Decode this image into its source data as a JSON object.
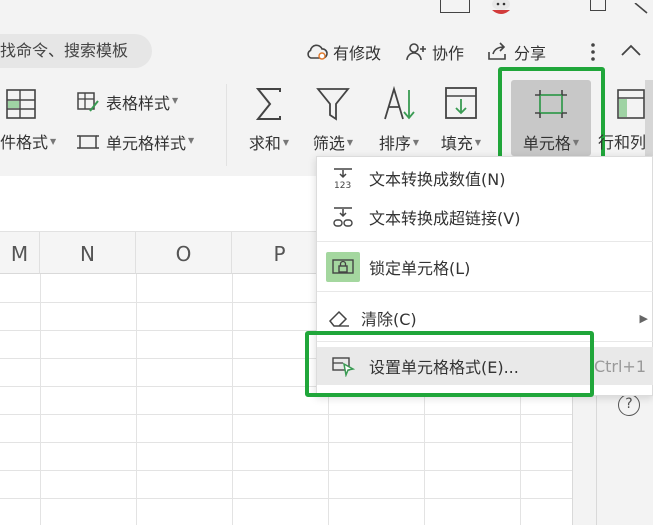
{
  "topbar": {
    "search_text": "找命令、搜索模板",
    "modified_label": "有修改",
    "collab_label": "协作",
    "share_label": "分享"
  },
  "ribbon": {
    "cond_format_label": "件格式",
    "table_style_label": "表格样式",
    "cell_style_label": "单元格样式",
    "sum_label": "求和",
    "filter_label": "筛选",
    "sort_label": "排序",
    "fill_label": "填充",
    "cell_label": "单元格",
    "rowcol_label": "行和列"
  },
  "sheet": {
    "columns": [
      "M",
      "N",
      "O",
      "P"
    ]
  },
  "menu": {
    "items": [
      {
        "label": "文本转换成数值(N)",
        "icon": "text-to-number-icon"
      },
      {
        "label": "文本转换成超链接(V)",
        "icon": "text-to-hyperlink-icon"
      },
      {
        "label": "锁定单元格(L)",
        "icon": "lock-cell-icon"
      },
      {
        "label": "清除(C)",
        "icon": "eraser-icon"
      },
      {
        "label": "设置单元格格式(E)...",
        "icon": "format-cells-icon",
        "shortcut": "Ctrl+1"
      }
    ]
  },
  "colors": {
    "highlight_green": "#20a63a",
    "active_button_bg": "#c8c8c8",
    "menu_hover_bg": "#e9e9e9"
  },
  "help": {
    "glyph": "?"
  }
}
